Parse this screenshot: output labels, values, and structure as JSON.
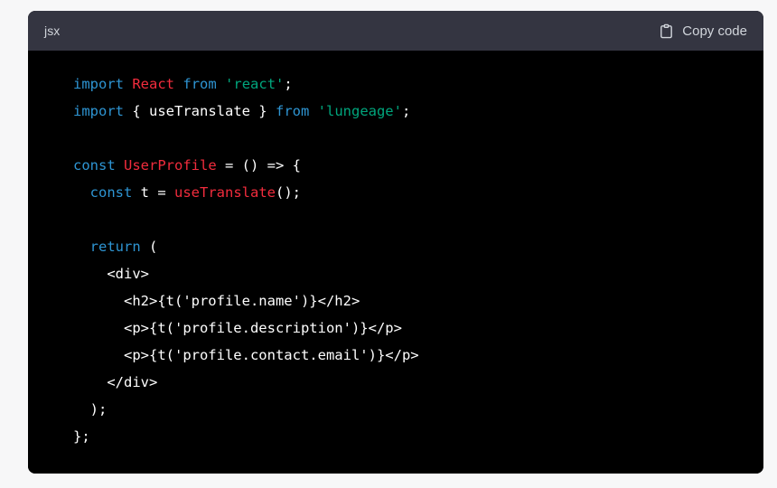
{
  "page": {
    "background": "#f7f7f8"
  },
  "code_block": {
    "language_label": "jsx",
    "copy_button": {
      "label": "Copy code",
      "icon": "clipboard-icon"
    },
    "theme": {
      "header_background": "#343541",
      "body_background": "#000000",
      "keyword_color": "#2e95d3",
      "class_color": "#f22c3d",
      "function_color": "#f22c3d",
      "string_color": "#00a67d",
      "plain_color": "#ffffff",
      "label_color": "#d1d5db"
    },
    "lines": [
      {
        "n": 1,
        "text": "import React from 'react';",
        "tokens": [
          {
            "t": "import",
            "c": "kw"
          },
          {
            "t": " ",
            "c": "pl"
          },
          {
            "t": "React",
            "c": "cls"
          },
          {
            "t": " ",
            "c": "pl"
          },
          {
            "t": "from",
            "c": "kw"
          },
          {
            "t": " ",
            "c": "pl"
          },
          {
            "t": "'react'",
            "c": "str"
          },
          {
            "t": ";",
            "c": "pl"
          }
        ]
      },
      {
        "n": 2,
        "text": "import { useTranslate } from 'lungeage';",
        "tokens": [
          {
            "t": "import",
            "c": "kw"
          },
          {
            "t": " { useTranslate } ",
            "c": "pl"
          },
          {
            "t": "from",
            "c": "kw"
          },
          {
            "t": " ",
            "c": "pl"
          },
          {
            "t": "'lungeage'",
            "c": "str"
          },
          {
            "t": ";",
            "c": "pl"
          }
        ]
      },
      {
        "n": 3,
        "text": "",
        "tokens": []
      },
      {
        "n": 4,
        "text": "const UserProfile = () => {",
        "tokens": [
          {
            "t": "const",
            "c": "kw"
          },
          {
            "t": " ",
            "c": "pl"
          },
          {
            "t": "UserProfile",
            "c": "cls"
          },
          {
            "t": " = () => {",
            "c": "pl"
          }
        ]
      },
      {
        "n": 5,
        "text": "  const t = useTranslate();",
        "tokens": [
          {
            "t": "  ",
            "c": "pl"
          },
          {
            "t": "const",
            "c": "kw"
          },
          {
            "t": " t = ",
            "c": "pl"
          },
          {
            "t": "useTranslate",
            "c": "fn"
          },
          {
            "t": "();",
            "c": "pl"
          }
        ]
      },
      {
        "n": 6,
        "text": "",
        "tokens": []
      },
      {
        "n": 7,
        "text": "  return (",
        "tokens": [
          {
            "t": "  ",
            "c": "pl"
          },
          {
            "t": "return",
            "c": "kw"
          },
          {
            "t": " (",
            "c": "pl"
          }
        ]
      },
      {
        "n": 8,
        "text": "    <div>",
        "tokens": [
          {
            "t": "    <div>",
            "c": "pl"
          }
        ]
      },
      {
        "n": 9,
        "text": "      <h2>{t('profile.name')}</h2>",
        "tokens": [
          {
            "t": "      <h2>{t('profile.name')}</h2>",
            "c": "pl"
          }
        ]
      },
      {
        "n": 10,
        "text": "      <p>{t('profile.description')}</p>",
        "tokens": [
          {
            "t": "      <p>{t('profile.description')}</p>",
            "c": "pl"
          }
        ]
      },
      {
        "n": 11,
        "text": "      <p>{t('profile.contact.email')}</p>",
        "tokens": [
          {
            "t": "      <p>{t('profile.contact.email')}</p>",
            "c": "pl"
          }
        ]
      },
      {
        "n": 12,
        "text": "    </div>",
        "tokens": [
          {
            "t": "    </div>",
            "c": "pl"
          }
        ]
      },
      {
        "n": 13,
        "text": "  );",
        "tokens": [
          {
            "t": "  );",
            "c": "pl"
          }
        ]
      },
      {
        "n": 14,
        "text": "};",
        "tokens": [
          {
            "t": "};",
            "c": "pl"
          }
        ]
      }
    ]
  }
}
